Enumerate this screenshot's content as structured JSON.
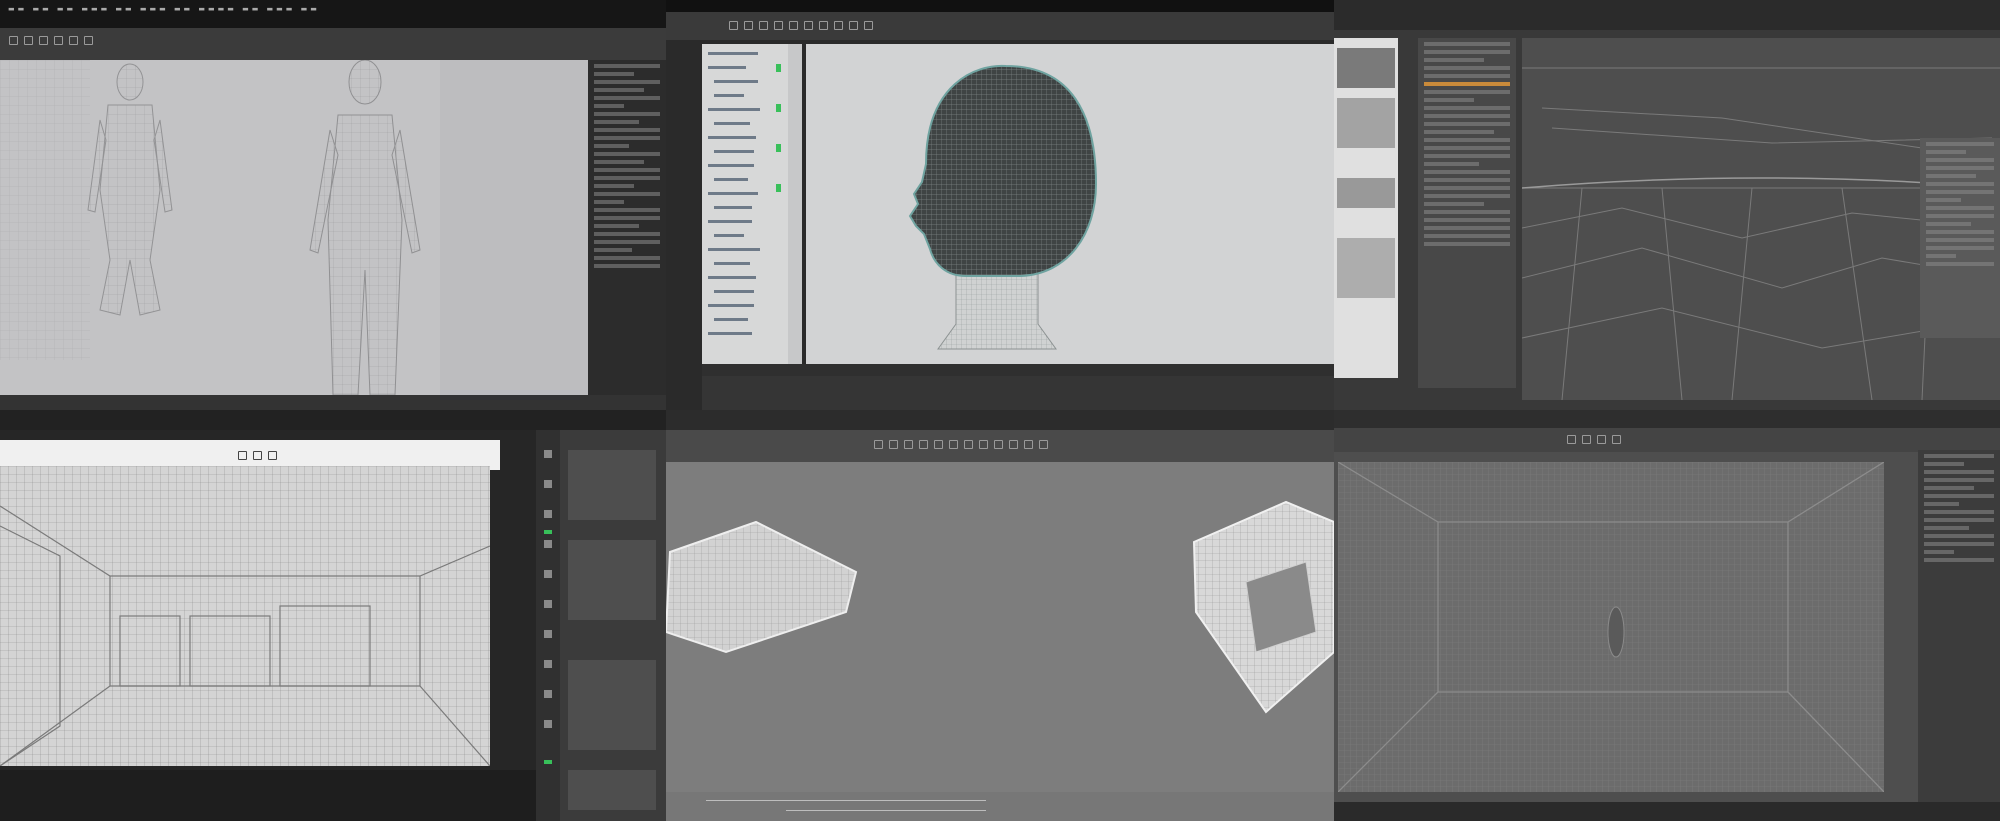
{
  "panels": [
    {
      "id": "figures",
      "type": "wireframe viewport"
    },
    {
      "id": "head",
      "type": "wireframe viewport"
    },
    {
      "id": "terrain",
      "type": "wireframe viewport"
    },
    {
      "id": "room",
      "type": "wireframe viewport"
    },
    {
      "id": "objects",
      "type": "wireframe viewport"
    },
    {
      "id": "interior",
      "type": "wireframe viewport"
    }
  ],
  "colors": {
    "ui_dark": "#1b1b1b",
    "ui_panel": "#2b2b2b",
    "viewport_grey": "#cfd1d2",
    "wire": "#4a4a4a",
    "accent_green": "#38c05a",
    "accent_orange": "#c98a3a",
    "accent_blue": "#3aa0d8"
  },
  "icons": [
    "grid-icon",
    "cursor-icon",
    "move-icon",
    "rotate-icon",
    "scale-icon",
    "camera-icon"
  ]
}
